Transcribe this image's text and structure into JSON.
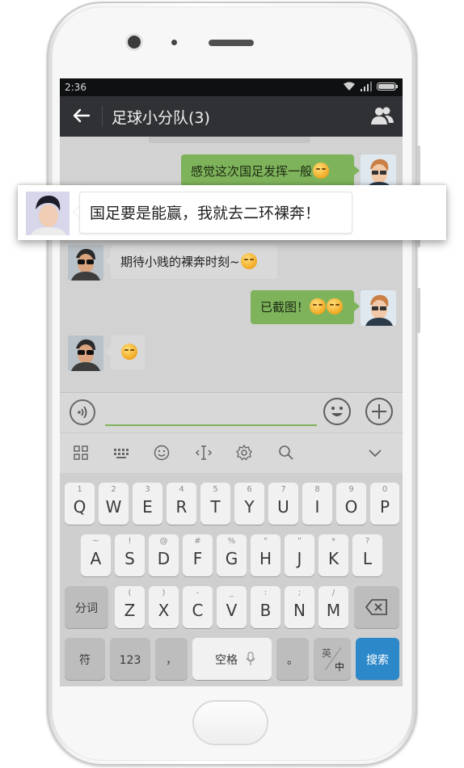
{
  "status": {
    "time": "2:36"
  },
  "header": {
    "title": "足球小分队(3)"
  },
  "messages": [
    {
      "side": "me",
      "text": "感觉这次国足发挥一般"
    },
    {
      "side": "other",
      "text": "国足要是能赢，我就去二环裸奔！"
    },
    {
      "side": "other",
      "text": "期待小贱的裸奔时刻~"
    },
    {
      "side": "me",
      "text": "已截图！"
    },
    {
      "side": "other",
      "text": ""
    }
  ],
  "keyboard": {
    "row1": [
      {
        "hint": "1",
        "key": "Q"
      },
      {
        "hint": "2",
        "key": "W"
      },
      {
        "hint": "3",
        "key": "E"
      },
      {
        "hint": "4",
        "key": "R"
      },
      {
        "hint": "5",
        "key": "T"
      },
      {
        "hint": "6",
        "key": "Y"
      },
      {
        "hint": "7",
        "key": "U"
      },
      {
        "hint": "8",
        "key": "I"
      },
      {
        "hint": "9",
        "key": "O"
      },
      {
        "hint": "0",
        "key": "P"
      }
    ],
    "row2": [
      {
        "hint": "~",
        "key": "A"
      },
      {
        "hint": "!",
        "key": "S"
      },
      {
        "hint": "@",
        "key": "D"
      },
      {
        "hint": "#",
        "key": "F"
      },
      {
        "hint": "%",
        "key": "G"
      },
      {
        "hint": "“",
        "key": "H"
      },
      {
        "hint": "”",
        "key": "J"
      },
      {
        "hint": "*",
        "key": "K"
      },
      {
        "hint": "?",
        "key": "L"
      }
    ],
    "row3": [
      {
        "hint": "(",
        "key": "Z"
      },
      {
        "hint": ")",
        "key": "X"
      },
      {
        "hint": "-",
        "key": "C"
      },
      {
        "hint": "_",
        "key": "V"
      },
      {
        "hint": ":",
        "key": "B"
      },
      {
        "hint": ";",
        "key": "N"
      },
      {
        "hint": "/",
        "key": "M"
      }
    ],
    "fenci": "分词",
    "fu": "符",
    "num": "123",
    "comma": "，",
    "space": "空格",
    "period": "。",
    "lang_top": "英",
    "lang_bottom": "中",
    "search": "搜索"
  },
  "colors": {
    "my_bubble": "#7fb35b",
    "search_key": "#2c88c9"
  }
}
